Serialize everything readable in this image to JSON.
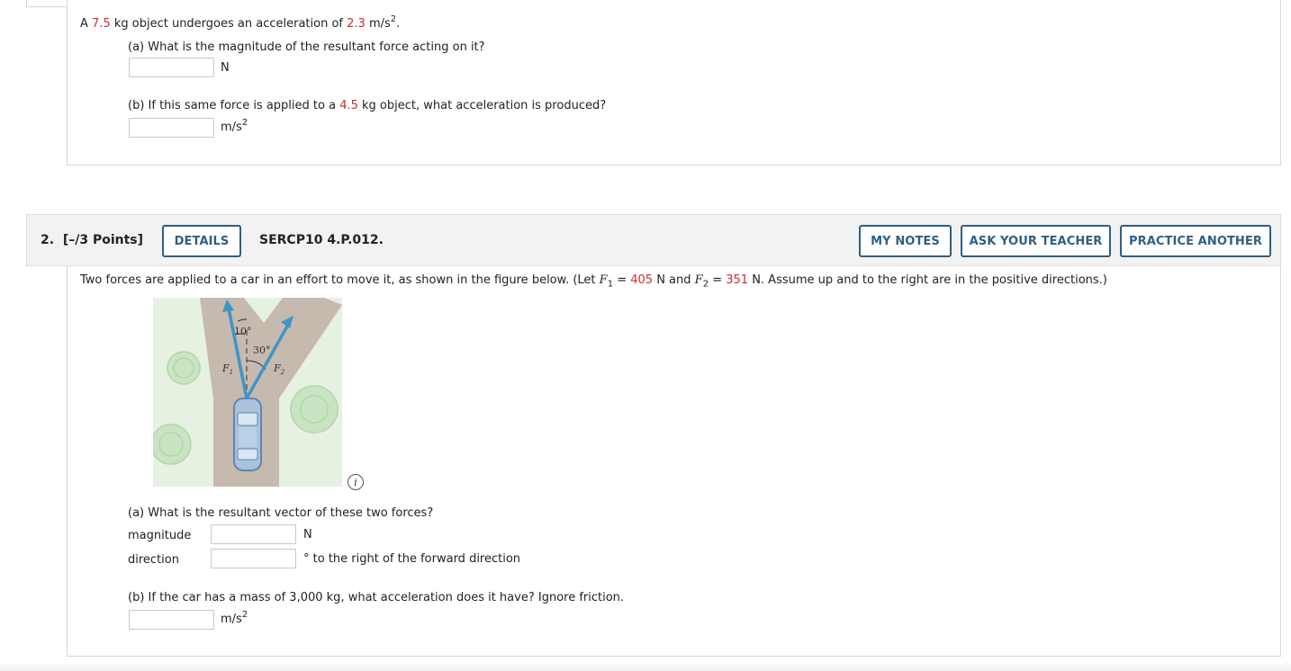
{
  "q1": {
    "intro_pre": "A ",
    "mass": "7.5",
    "intro_mid": " kg object undergoes an acceleration of ",
    "accel": "2.3",
    "intro_unit": " m/s",
    "intro_exp": "2",
    "intro_end": ".",
    "part_a": "(a) What is the magnitude of the resultant force acting on it?",
    "part_a_unit": "N",
    "part_b_pre": "(b) If this same force is applied to a ",
    "part_b_mass": "4.5",
    "part_b_post": " kg object, what acceleration is produced?",
    "part_b_unit": "m/s",
    "part_b_exp": "2"
  },
  "q2": {
    "number": "2.",
    "points": "[–/3 Points]",
    "details_label": "DETAILS",
    "problem_id": "SERCP10 4.P.012.",
    "my_notes_label": "MY NOTES",
    "ask_teacher_label": "ASK YOUR TEACHER",
    "practice_label": "PRACTICE ANOTHER",
    "intro_1": "Two forces are applied to a car in an effort to move it, as shown in the figure below. (Let ",
    "f1_sym": "F",
    "f1_sub": "1",
    "eq": " = ",
    "f1_val": "405",
    "intro_2": " N and ",
    "f2_sym": "F",
    "f2_sub": "2",
    "f2_val": "351",
    "intro_3": " N. Assume up and to the right are in the positive directions.)",
    "figure": {
      "angle1": "10°",
      "angle2": "30°",
      "label_f1": "F",
      "label_f1_sub": "1",
      "label_f2": "F",
      "label_f2_sub": "2"
    },
    "info_glyph": "i",
    "part_a": "(a) What is the resultant vector of these two forces?",
    "magnitude_label": "magnitude",
    "magnitude_unit": "N",
    "direction_label": "direction",
    "direction_unit": "° to the right of the forward direction",
    "part_b": "(b) If the car has a mass of 3,000 kg, what acceleration does it have? Ignore friction.",
    "part_b_unit": "m/s",
    "part_b_exp": "2"
  },
  "colors": {
    "highlight": "#d12b2b",
    "button": "#2f5f86",
    "road": "#c6b9ad",
    "grass": "#e6f1e2",
    "arrow": "#3d96c8"
  }
}
